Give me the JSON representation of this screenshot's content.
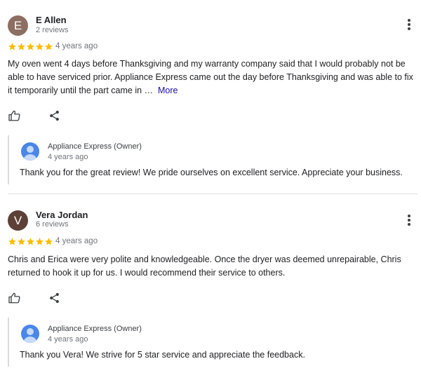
{
  "reviews": [
    {
      "initial": "E",
      "avatar_color": "#8d6e63",
      "name": "E Allen",
      "review_count": "2 reviews",
      "rating": 5,
      "date": "4 years ago",
      "text_line1": "My oven went 4 days before Thanksgiving and my warranty company said that I would probably not be",
      "text_line2": "able to have serviced prior. Appliance Express came out the day before Thanksgiving and was able to fix",
      "text_line3": "it temporarily until the part came in …",
      "more_label": "More",
      "reply": {
        "owner": "Appliance Express (Owner)",
        "date": "4 years ago",
        "text": "Thank you for the great review! We pride ourselves on excellent service. Appreciate your business."
      }
    },
    {
      "initial": "V",
      "avatar_color": "#5d4037",
      "name": "Vera Jordan",
      "review_count": "6 reviews",
      "rating": 5,
      "date": "4 years ago",
      "text_line1": "Chris and Erica were very polite and knowledgeable. Once the dryer was deemed unrepairable, Chris",
      "text_line2": "returned to hook it up for us. I would recommend their service to others.",
      "reply": {
        "owner": "Appliance Express (Owner)",
        "date": "4 years ago",
        "text": "Thank you Vera! We strive for 5 star service and appreciate the feedback."
      }
    }
  ],
  "colors": {
    "star": "#fbbc04",
    "link": "#1a0dab",
    "owner_avatar": "#4a86e8"
  },
  "icons": [
    "thumbs-up-icon",
    "share-icon",
    "more-vert-icon",
    "star-icon",
    "person-icon"
  ]
}
